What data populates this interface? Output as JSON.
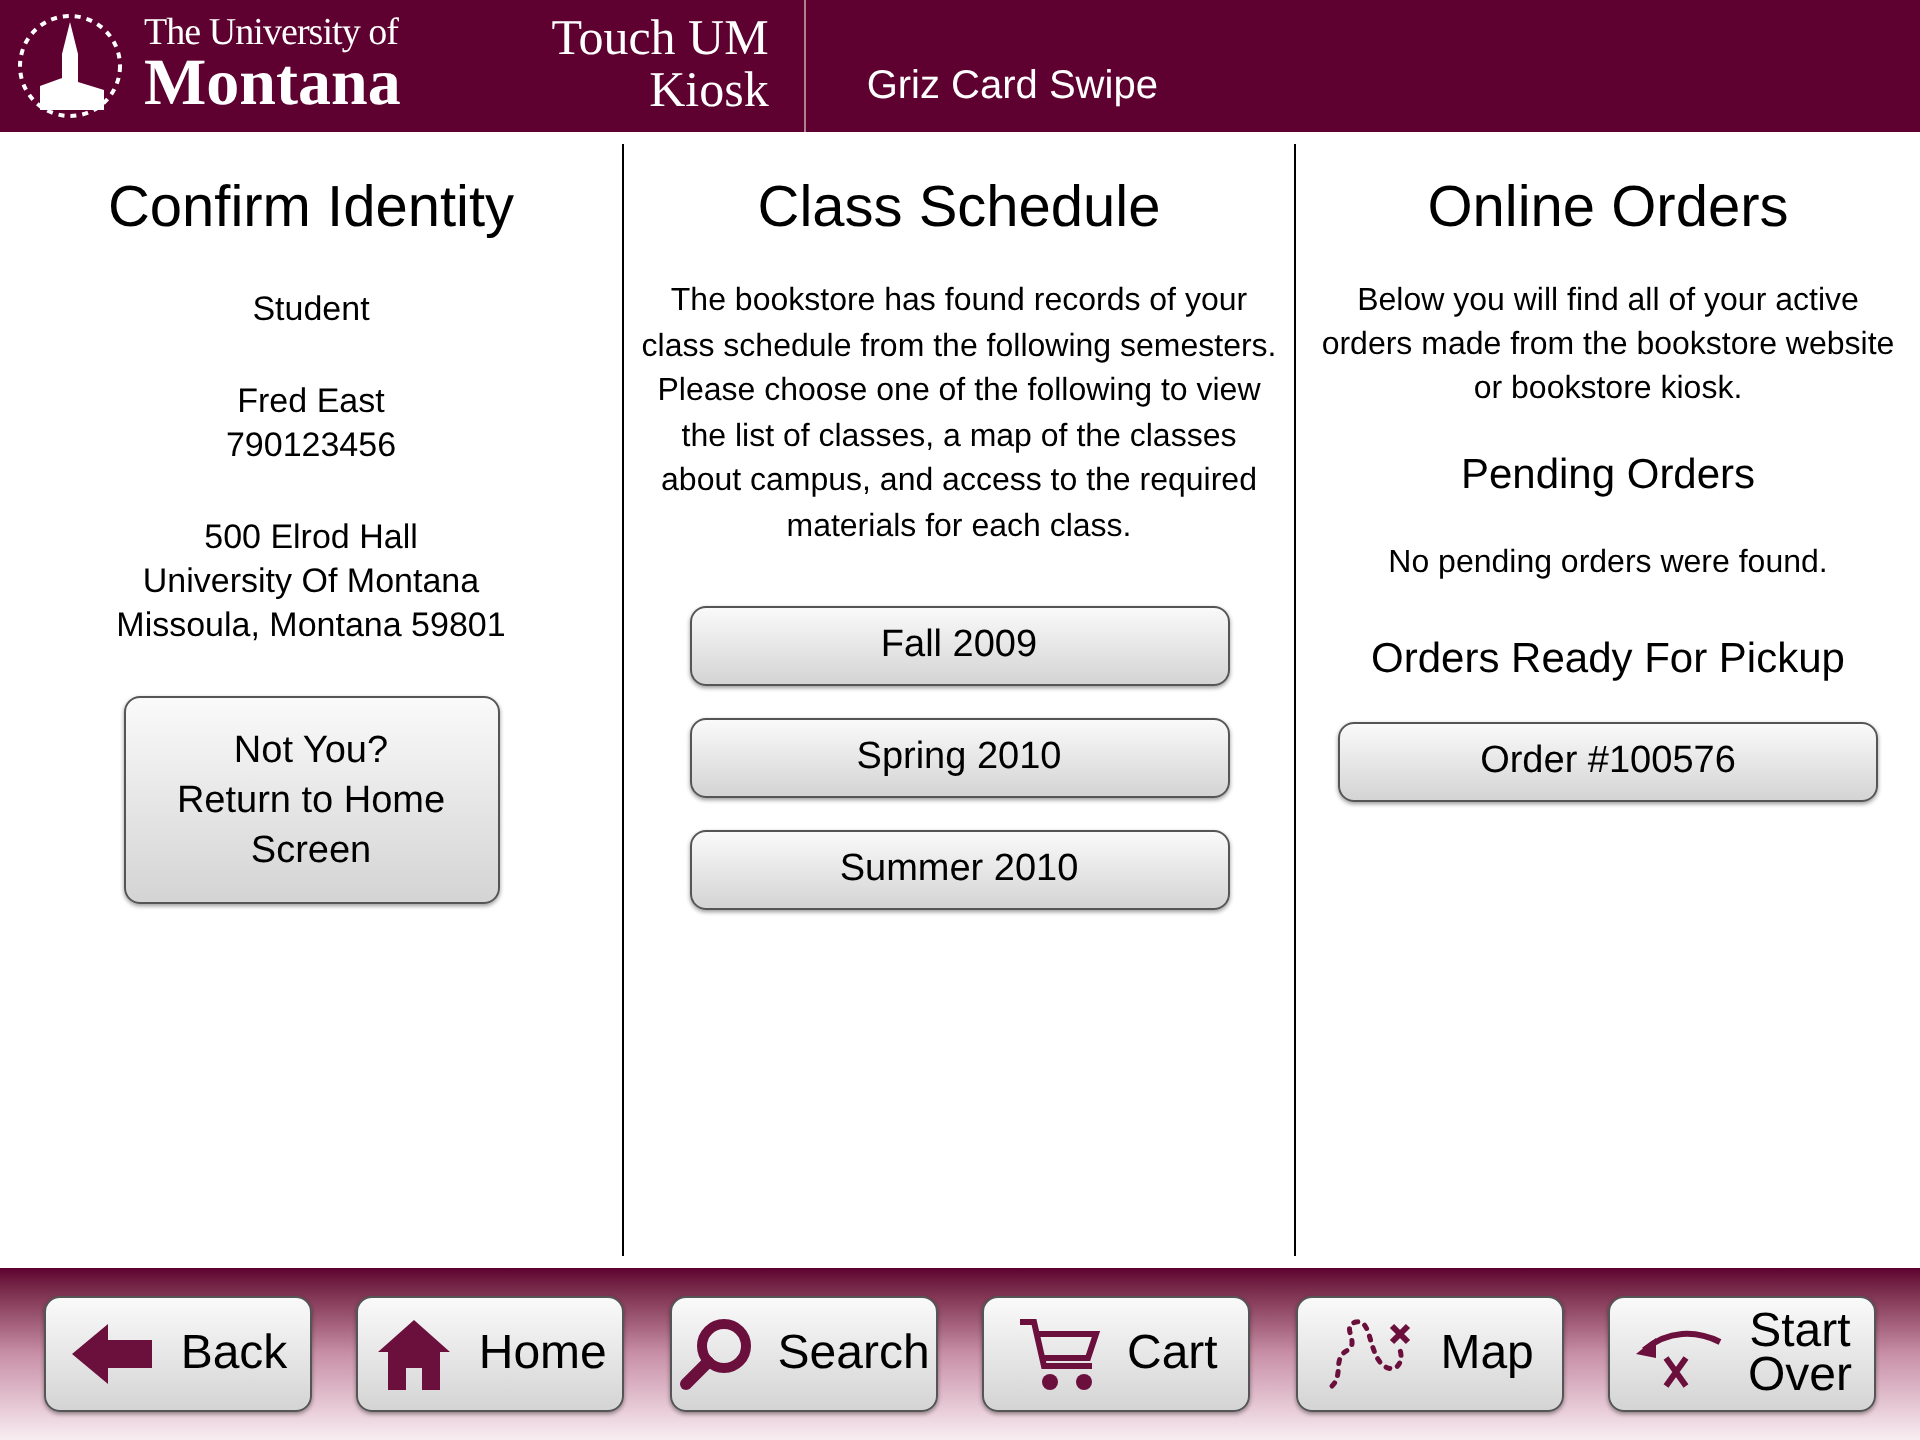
{
  "header": {
    "university_line": "The University of",
    "university_name": "Montana",
    "kiosk_title": "Touch UM",
    "kiosk_subtitle": "Kiosk",
    "page_title": "Griz Card Swipe"
  },
  "columns": [
    {
      "kind": "identity",
      "title": "Confirm Identity",
      "role": "Student",
      "name": "Fred East",
      "id": "790123456",
      "address": [
        "500 Elrod Hall",
        "University Of Montana",
        "Missoula, Montana 59801"
      ],
      "button": "Not You? Return to Home Screen"
    },
    {
      "kind": "schedule",
      "title": "Class Schedule",
      "description": "The bookstore has found records of your class schedule from the following semesters.  Please choose one of the following to view the list of classes, a map of the classes about campus, and access to the required materials for each class.",
      "semesters": [
        "Fall 2009",
        "Spring 2010",
        "Summer 2010"
      ]
    },
    {
      "kind": "orders",
      "title": "Online Orders",
      "description": "Below you will find all of your active orders made from the bookstore website or bookstore kiosk.",
      "pending_heading": "Pending Orders",
      "pending_message": "No pending orders were found.",
      "ready_heading": "Orders Ready For Pickup",
      "ready_orders": [
        "Order #100576"
      ]
    }
  ],
  "nav": [
    {
      "kind": "back",
      "label": "Back"
    },
    {
      "kind": "home",
      "label": "Home"
    },
    {
      "kind": "search",
      "label": "Search"
    },
    {
      "kind": "cart",
      "label": "Cart"
    },
    {
      "kind": "map",
      "label": "Map"
    },
    {
      "kind": "start_over",
      "label": "Start Over"
    }
  ]
}
